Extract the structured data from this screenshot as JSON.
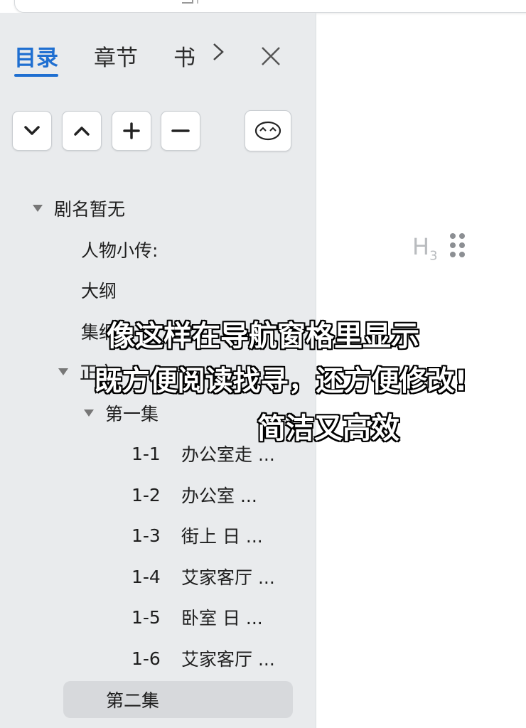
{
  "tabs": [
    {
      "label": "目录",
      "active": true
    },
    {
      "label": "章节",
      "active": false
    },
    {
      "label": "书",
      "active": false
    }
  ],
  "icons": {
    "tab_more": "chevron-right-icon",
    "close": "close-icon",
    "expand": "chevron-down-icon",
    "collapse": "chevron-up-icon",
    "add": "plus-icon",
    "remove": "minus-icon",
    "outline_toggle": "face-toggle-icon"
  },
  "tree": {
    "root": "剧名暂无",
    "items": [
      "人物小传:",
      "大纲",
      "集纲"
    ],
    "body": "正文",
    "episode1": "第一集",
    "scenes": [
      {
        "num": "1-1",
        "title": "办公室走 ..."
      },
      {
        "num": "1-2",
        "title": "办公室  ..."
      },
      {
        "num": "1-3",
        "title": "街上  日  ..."
      },
      {
        "num": "1-4",
        "title": "艾家客厅 ..."
      },
      {
        "num": "1-5",
        "title": "卧室  日  ..."
      },
      {
        "num": "1-6",
        "title": "艾家客厅 ..."
      }
    ],
    "episode2": "第二集"
  },
  "editor": {
    "heading_marker": "H",
    "heading_level": "3"
  },
  "caption": [
    "像这样在导航窗格里显示",
    "既方便阅读找寻，还方便修改!",
    "简洁又高效"
  ],
  "colors": {
    "accent": "#1f6fd1",
    "sidebar_bg": "#e9ebed",
    "selected_bg": "#d7d9dc"
  }
}
